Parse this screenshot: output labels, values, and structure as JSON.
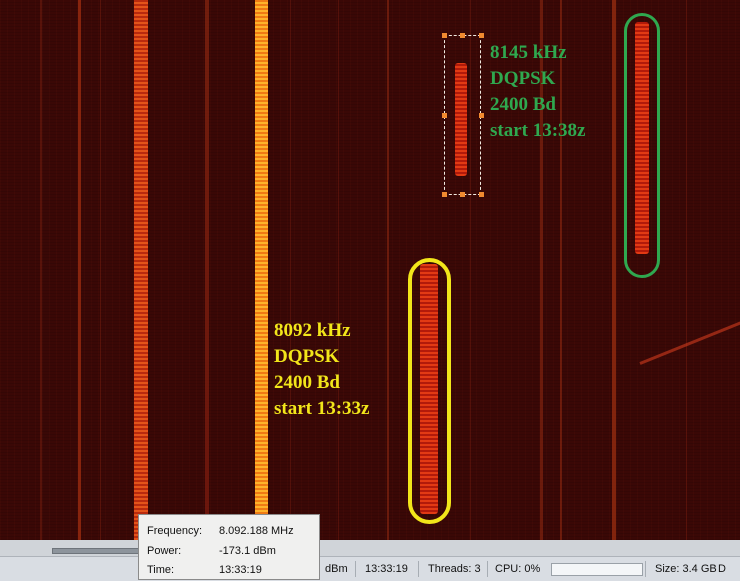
{
  "annotations": {
    "green": {
      "frequency": "8145 kHz",
      "mode": "DQPSK",
      "rate": "2400 Bd",
      "start": "start 13:38z",
      "color": "#2fa84f"
    },
    "yellow": {
      "frequency": "8092 kHz",
      "mode": "DQPSK",
      "rate": "2400 Bd",
      "start": "start 13:33z",
      "color": "#f2e61a"
    }
  },
  "tooltip": {
    "frequency_label": "Frequency:",
    "frequency_value": "8.092.188 MHz",
    "power_label": "Power:",
    "power_value": "-173.1 dBm",
    "time_label": "Time:",
    "time_value": "13:33:19"
  },
  "statusbar": {
    "power_unit": "dBm",
    "time": "13:33:19",
    "threads": "Threads: 3",
    "cpu": "CPU: 0%",
    "size": "Size: 3.4 GB",
    "drive_letter": "D"
  },
  "colors": {
    "background": "#3a0806",
    "signal_bright": "#ff9a1a",
    "burst_red": "#e23a14",
    "selection_handle": "#f08a30"
  }
}
